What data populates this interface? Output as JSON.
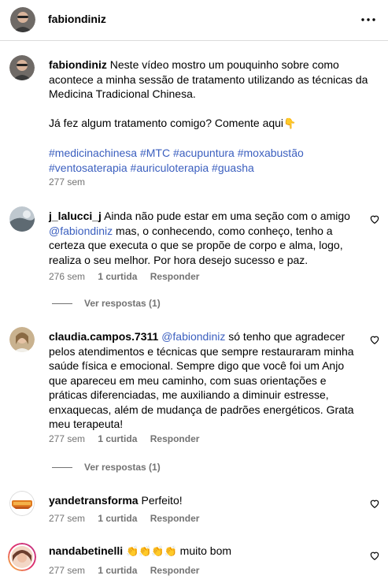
{
  "post": {
    "username": "fabiondiniz",
    "caption_lines": [
      "Neste vídeo mostro um pouquinho sobre como",
      "acontece a minha sessão de tratamento utilizando as técnicas da",
      "Medicina Tradicional Chinesa."
    ],
    "question": "Já fez algum tratamento comigo? Comente aqui",
    "hashtags_line1": [
      "#medicinachinesa",
      "#MTC",
      "#acupuntura",
      "#moxabustão"
    ],
    "hashtags_line2": [
      "#ventosaterapia",
      "#auriculoterapia",
      "#guasha"
    ],
    "time": "277 sem",
    "pointing_emoji": "👇"
  },
  "comments": [
    {
      "username": "j_lalucci_j",
      "lines": [
        "Ainda não pude estar em uma seção com o amigo",
        "mas, o conhecendo, como conheço, tenho a",
        "certeza que executa o que se propõe de corpo e alma, logo,",
        "realiza o seu melhor. Por hora desejo sucesso e paz."
      ],
      "mention": "@fabiondiniz",
      "time": "276 sem",
      "likes": "1 curtida",
      "reply": "Responder",
      "view_replies": "Ver respostas (1)"
    },
    {
      "username": "claudia.campos.7311",
      "mention": "@fabiondiniz",
      "lines": [
        "só tenho que agradecer",
        "pelos atendimentos e técnicas que sempre restauraram minha",
        "saúde física e emocional. Sempre digo que você foi um Anjo",
        "que apareceu em meu caminho, com suas orientações e",
        "práticas diferenciadas, me auxiliando a diminuir estresse,",
        "enxaquecas, além de mudança de padrões energéticos. Grata",
        "meu terapeuta!"
      ],
      "time": "277 sem",
      "likes": "1 curtida",
      "reply": "Responder",
      "view_replies": "Ver respostas (1)"
    },
    {
      "username": "yandetransforma",
      "text": "Perfeito!",
      "time": "277 sem",
      "likes": "1 curtida",
      "reply": "Responder"
    },
    {
      "username": "nandabetinelli",
      "emojis": "👏👏👏👏",
      "text": "muito bom",
      "time": "277 sem",
      "likes": "1 curtida",
      "reply": "Responder"
    }
  ],
  "icons": {
    "more": "more-options-icon",
    "heart": "heart-outline-icon"
  },
  "colors": {
    "link": "#3b5fbf",
    "meta": "#737373",
    "divider": "#dbdbdb"
  }
}
